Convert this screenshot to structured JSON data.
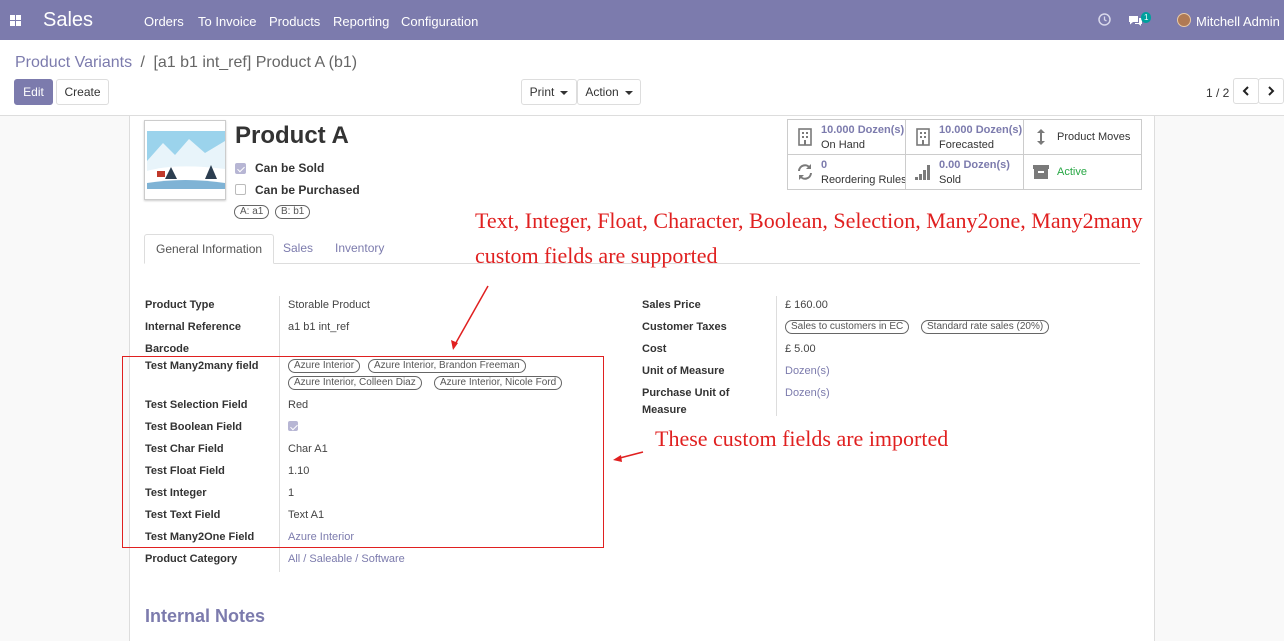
{
  "nav": {
    "app": "Sales",
    "menu": [
      "Orders",
      "To Invoice",
      "Products",
      "Reporting",
      "Configuration"
    ],
    "badge": "1",
    "user": "Mitchell Admin"
  },
  "breadcrumb": {
    "parent": "Product Variants",
    "separator": "/",
    "current": "[a1 b1 int_ref] Product A (b1)"
  },
  "buttons": {
    "edit": "Edit",
    "create": "Create",
    "print": "Print",
    "action": "Action"
  },
  "pager": {
    "value": "1 / 2"
  },
  "product": {
    "name": "Product A",
    "can_be_sold": "Can be Sold",
    "can_be_purchased": "Can be Purchased",
    "can_be_sold_checked": true,
    "can_be_purchased_checked": false,
    "attributes": [
      "A: a1",
      "B: b1"
    ]
  },
  "smart_buttons": [
    {
      "value": "10.000 Dozen(s)",
      "label": "On Hand",
      "icon": "building-icon"
    },
    {
      "value": "10.000 Dozen(s)",
      "label": "Forecasted",
      "icon": "building-icon"
    },
    {
      "value": "",
      "label": "Product Moves",
      "icon": "updown-arrow-icon"
    },
    {
      "value": "0",
      "label": "Reordering Rules",
      "icon": "refresh-icon"
    },
    {
      "value": "0.00 Dozen(s)",
      "label": "Sold",
      "icon": "signal-icon"
    },
    {
      "value": "",
      "label": "Active",
      "icon": "archive-icon"
    }
  ],
  "tabs": [
    "General Information",
    "Sales",
    "Inventory"
  ],
  "left_fields": {
    "product_type": {
      "label": "Product Type",
      "value": "Storable Product"
    },
    "internal_ref": {
      "label": "Internal Reference",
      "value": "a1 b1 int_ref"
    },
    "barcode": {
      "label": "Barcode",
      "value": ""
    },
    "m2m": {
      "label": "Test Many2many field",
      "tags": [
        "Azure Interior",
        "Azure Interior, Brandon Freeman",
        "Azure Interior, Colleen Diaz",
        "Azure Interior, Nicole Ford"
      ]
    },
    "selection": {
      "label": "Test Selection Field",
      "value": "Red"
    },
    "boolean": {
      "label": "Test Boolean Field",
      "checked": true
    },
    "char": {
      "label": "Test Char Field",
      "value": "Char A1"
    },
    "float": {
      "label": "Test Float Field",
      "value": "1.10"
    },
    "integer": {
      "label": "Test Integer",
      "value": "1"
    },
    "text": {
      "label": "Test Text Field",
      "value": "Text A1"
    },
    "m2o": {
      "label": "Test Many2One Field",
      "value": "Azure Interior"
    },
    "category": {
      "label": "Product Category",
      "value": "All / Saleable / Software"
    }
  },
  "right_fields": {
    "sales_price": {
      "label": "Sales Price",
      "value": "£ 160.00"
    },
    "customer_taxes": {
      "label": "Customer Taxes",
      "tags": [
        "Sales to customers in EC",
        "Standard rate sales (20%)"
      ]
    },
    "cost": {
      "label": "Cost",
      "value": "£ 5.00"
    },
    "uom": {
      "label": "Unit of Measure",
      "value": "Dozen(s)"
    },
    "purchase_uom": {
      "label_line1": "Purchase Unit of",
      "label_line2": "Measure",
      "value": "Dozen(s)"
    }
  },
  "annotations": {
    "line1": "Text, Integer, Float, Character, Boolean, Selection, Many2one, Many2many",
    "line2": "custom fields are supported",
    "line3": "These custom fields are imported"
  },
  "internal_notes": "Internal Notes",
  "colors": {
    "brand": "#7c7bad",
    "annotation": "#e02020",
    "active": "#28a745"
  }
}
